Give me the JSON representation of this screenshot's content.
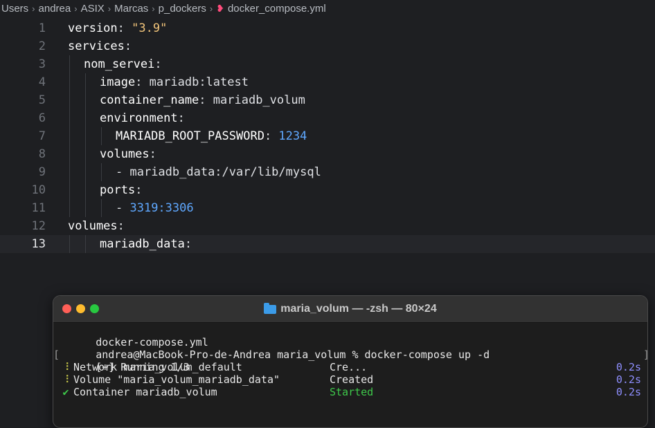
{
  "breadcrumb": {
    "segments": [
      "Users",
      "andrea",
      "ASIX",
      "Marcas",
      "p_dockers"
    ],
    "file_name": "docker_compose.yml"
  },
  "editor": {
    "current_line": 13,
    "lines": [
      {
        "n": "1",
        "indent": 0,
        "key": "version",
        "sep": ": ",
        "value": "\"3.9\"",
        "vtype": "str"
      },
      {
        "n": "2",
        "indent": 0,
        "key": "services",
        "sep": ":",
        "value": "",
        "vtype": "val"
      },
      {
        "n": "3",
        "indent": 1,
        "key": "nom_servei",
        "sep": ":",
        "value": "",
        "vtype": "val"
      },
      {
        "n": "4",
        "indent": 2,
        "key": "image",
        "sep": ": ",
        "value": "mariadb:latest",
        "vtype": "val"
      },
      {
        "n": "5",
        "indent": 2,
        "key": "container_name",
        "sep": ": ",
        "value": "mariadb_volum",
        "vtype": "val"
      },
      {
        "n": "6",
        "indent": 2,
        "key": "environment",
        "sep": ":",
        "value": "",
        "vtype": "val"
      },
      {
        "n": "7",
        "indent": 3,
        "key": "MARIADB_ROOT_PASSWORD",
        "sep": ": ",
        "value": "1234",
        "vtype": "num"
      },
      {
        "n": "8",
        "indent": 2,
        "key": "volumes",
        "sep": ":",
        "value": "",
        "vtype": "val"
      },
      {
        "n": "9",
        "indent": 3,
        "key": "",
        "sep": "- ",
        "value": "mariadb_data:/var/lib/mysql",
        "vtype": "val"
      },
      {
        "n": "10",
        "indent": 2,
        "key": "ports",
        "sep": ":",
        "value": "",
        "vtype": "val"
      },
      {
        "n": "11",
        "indent": 3,
        "key": "",
        "sep": "- ",
        "value": "3319:3306",
        "vtype": "num"
      },
      {
        "n": "12",
        "indent": 0,
        "key": "volumes",
        "sep": ":",
        "value": "",
        "vtype": "val"
      },
      {
        "n": "13",
        "indent": 2,
        "key": "mariadb_data",
        "sep": ":",
        "value": "",
        "vtype": "val"
      }
    ]
  },
  "terminal": {
    "title": "maria_volum — -zsh — 80×24",
    "lines": {
      "ls_output": "docker-compose.yml",
      "prompt": "andrea@MacBook-Pro-de-Andrea maria_volum % docker-compose up -d",
      "running": "[+] Running 1/3"
    },
    "status_rows": [
      {
        "symbol": "⠸",
        "kind": "pending",
        "label": "Network maria_volum_default",
        "state": "Cre...",
        "state_color": "white",
        "time": "0.2s"
      },
      {
        "symbol": "⠸",
        "kind": "pending",
        "label": "Volume \"maria_volum_mariadb_data\"",
        "state": "Created",
        "state_color": "white",
        "time": "0.2s"
      },
      {
        "symbol": "✔",
        "kind": "done",
        "label": "Container mariadb_volum",
        "state": "Started",
        "state_color": "green",
        "time": "0.2s"
      }
    ]
  },
  "colors": {
    "editor_bg": "#1e1f22",
    "string": "#f1c47a",
    "number": "#5fa8ff",
    "success": "#3ec94a",
    "time": "#8f8fff",
    "file_icon": "#ff4b7c"
  }
}
